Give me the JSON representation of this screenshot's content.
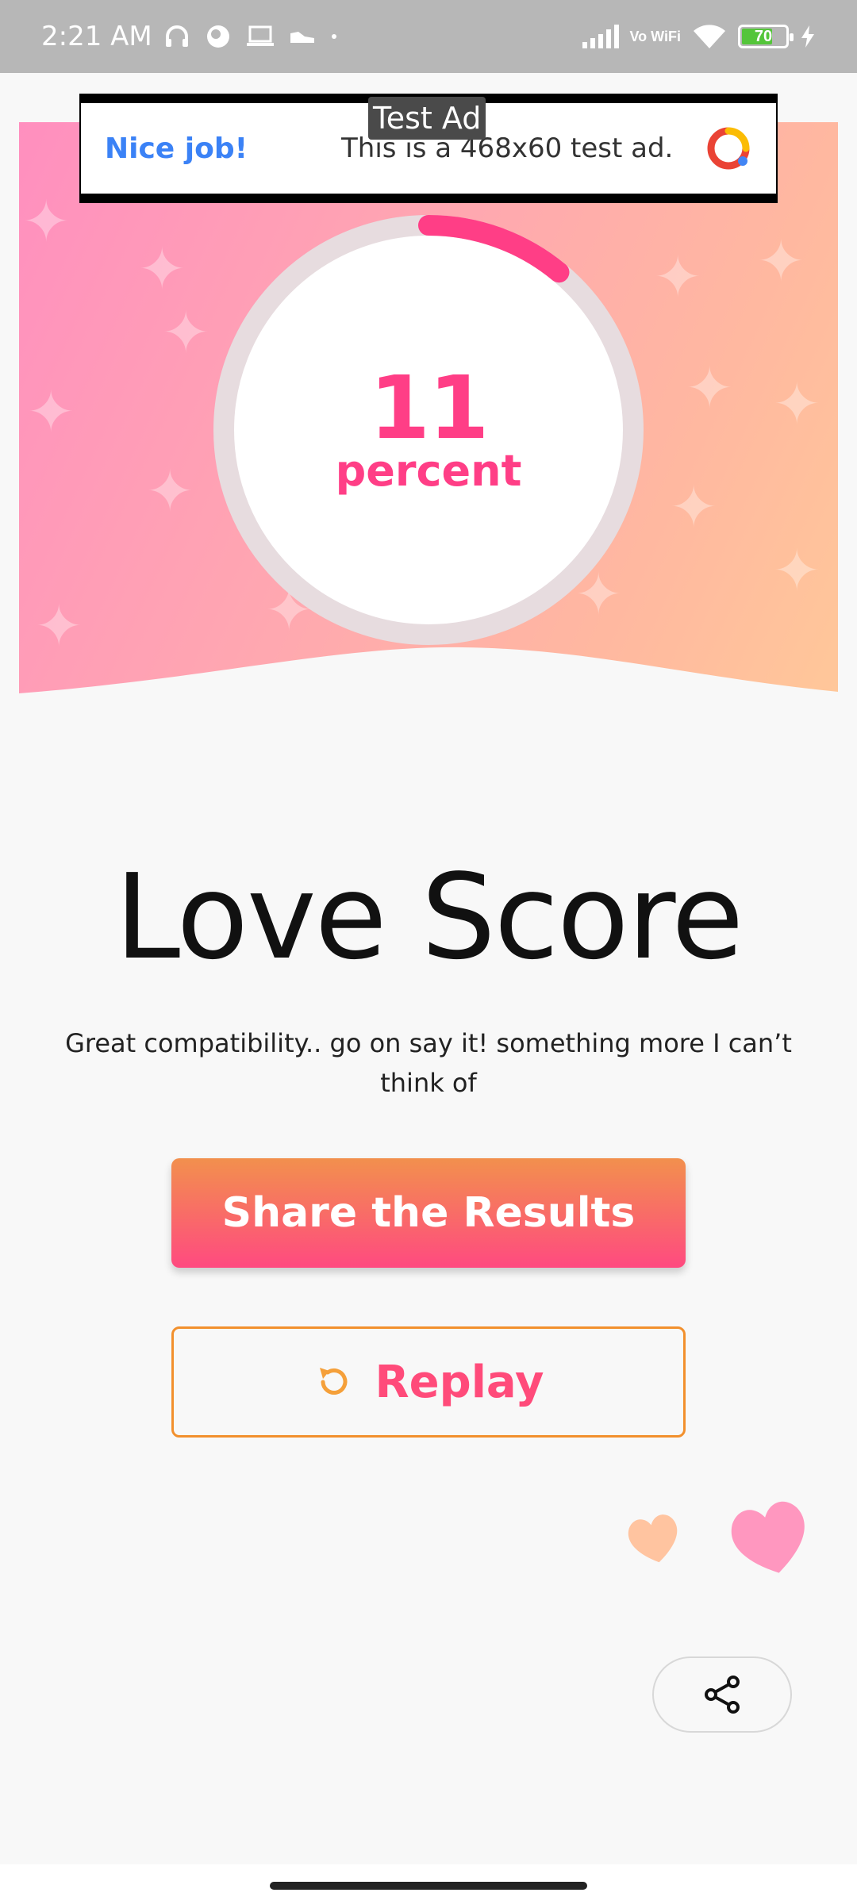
{
  "status_bar": {
    "time": "2:21 AM",
    "network_label": "Vo WiFi",
    "battery_level": "70"
  },
  "ad": {
    "tag": "Test Ad",
    "headline": "Nice job!",
    "body": "This is a 468x60 test ad."
  },
  "score": {
    "value": "11",
    "unit": "percent",
    "progress_fraction": 0.11,
    "colors": {
      "accent": "#ff3e86",
      "track": "#e7dcdf"
    }
  },
  "result": {
    "title": "Love Score",
    "description": "Great compatibility.. go on say it! something more I can’t think of"
  },
  "actions": {
    "share_label": "Share the Results",
    "replay_label": "Replay"
  },
  "icons": {
    "replay": "replay-icon",
    "share": "share-icon",
    "hearts": "heart-icon"
  }
}
